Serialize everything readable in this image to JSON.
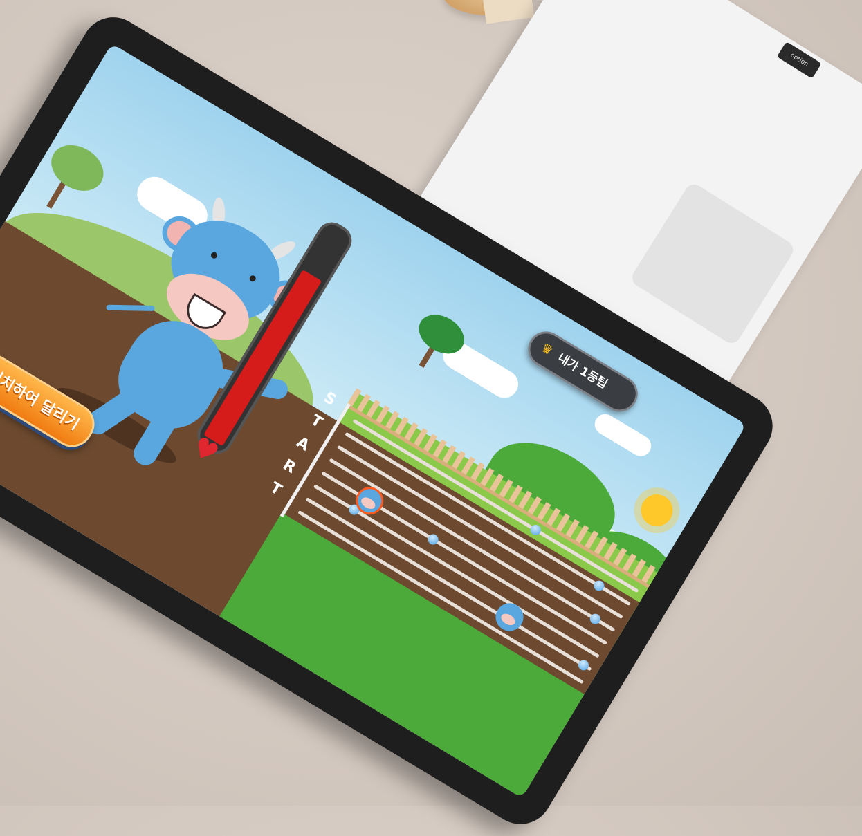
{
  "laptop": {
    "key_label": "option"
  },
  "game": {
    "tip_button_label": "내가 1등팁",
    "crown_icon": "crown-icon",
    "run_button_label": "터치하여 달리기",
    "start_letters": [
      "S",
      "T",
      "A",
      "R",
      "T"
    ],
    "power_gauge_level": 0.82,
    "colors": {
      "gauge_fill": "#d61b1b",
      "run_button": "#f07c12",
      "lane_marker": "#4b9fe0",
      "soil": "#6d4a2f",
      "grass": "#4caa3a"
    },
    "lanes": 8
  }
}
